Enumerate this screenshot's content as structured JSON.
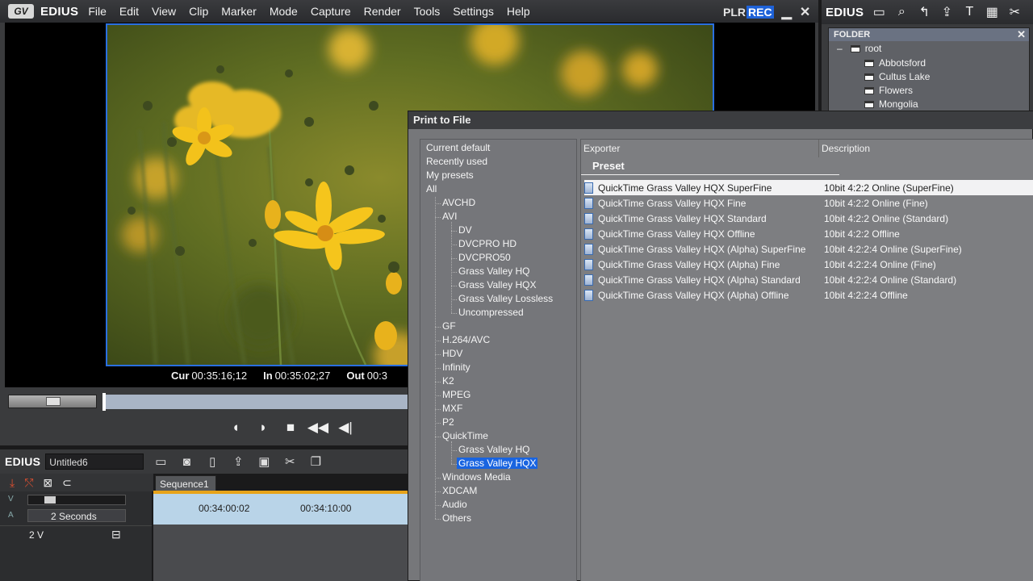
{
  "app": {
    "badge": "GV",
    "name": "EDIUS",
    "menu": [
      "File",
      "Edit",
      "View",
      "Clip",
      "Marker",
      "Mode",
      "Capture",
      "Render",
      "Tools",
      "Settings",
      "Help"
    ],
    "plr": "PLR",
    "rec": "REC"
  },
  "player": {
    "timecodes": [
      {
        "label": "Cur",
        "value": "00:35:16;12"
      },
      {
        "label": "In",
        "value": "00:35:02;27"
      },
      {
        "label": "Out",
        "value": "00:3"
      }
    ]
  },
  "timeline": {
    "brand": "EDIUS",
    "project": "Untitled6",
    "sequence_tab": "Sequence1",
    "zoom": "2 Seconds",
    "ruler_marks": [
      "00:34:00:02",
      "00:34:10:00"
    ],
    "track_name": "2 V"
  },
  "bin": {
    "brand": "EDIUS",
    "folder_header": "FOLDER",
    "root": "root",
    "folders": [
      "Abbotsford",
      "Cultus Lake",
      "Flowers",
      "Mongolia"
    ]
  },
  "dialog": {
    "title": "Print to File",
    "tree_top": [
      "Current default",
      "Recently used",
      "My presets",
      "All"
    ],
    "tree": [
      {
        "label": "AVCHD",
        "level": 1
      },
      {
        "label": "AVI",
        "level": 1
      },
      {
        "label": "DV",
        "level": 2
      },
      {
        "label": "DVCPRO HD",
        "level": 2
      },
      {
        "label": "DVCPRO50",
        "level": 2
      },
      {
        "label": "Grass Valley HQ",
        "level": 2
      },
      {
        "label": "Grass Valley HQX",
        "level": 2
      },
      {
        "label": "Grass Valley Lossless",
        "level": 2
      },
      {
        "label": "Uncompressed",
        "level": 2
      },
      {
        "label": "GF",
        "level": 1
      },
      {
        "label": "H.264/AVC",
        "level": 1
      },
      {
        "label": "HDV",
        "level": 1
      },
      {
        "label": "Infinity",
        "level": 1
      },
      {
        "label": "K2",
        "level": 1
      },
      {
        "label": "MPEG",
        "level": 1
      },
      {
        "label": "MXF",
        "level": 1
      },
      {
        "label": "P2",
        "level": 1
      },
      {
        "label": "QuickTime",
        "level": 1
      },
      {
        "label": "Grass Valley HQ",
        "level": 2
      },
      {
        "label": "Grass Valley HQX",
        "level": 2,
        "selected": true
      },
      {
        "label": "Windows Media",
        "level": 1
      },
      {
        "label": "XDCAM",
        "level": 1
      },
      {
        "label": "Audio",
        "level": 1
      },
      {
        "label": "Others",
        "level": 1
      }
    ],
    "columns": {
      "exporter": "Exporter",
      "description": "Description"
    },
    "preset_label": "Preset",
    "presets": [
      {
        "name": "QuickTime Grass Valley HQX SuperFine",
        "desc": "10bit 4:2:2 Online (SuperFine)",
        "selected": true
      },
      {
        "name": "QuickTime Grass Valley HQX Fine",
        "desc": "10bit 4:2:2 Online (Fine)"
      },
      {
        "name": "QuickTime Grass Valley HQX Standard",
        "desc": "10bit 4:2:2 Online (Standard)"
      },
      {
        "name": "QuickTime Grass Valley HQX Offline",
        "desc": "10bit 4:2:2 Offline"
      },
      {
        "name": "QuickTime Grass Valley HQX (Alpha) SuperFine",
        "desc": "10bit 4:2:2:4 Online (SuperFine)"
      },
      {
        "name": "QuickTime Grass Valley HQX (Alpha) Fine",
        "desc": "10bit 4:2:2:4 Online (Fine)"
      },
      {
        "name": "QuickTime Grass Valley HQX (Alpha) Standard",
        "desc": "10bit 4:2:2:4 Online (Standard)"
      },
      {
        "name": "QuickTime Grass Valley HQX (Alpha) Offline",
        "desc": "10bit 4:2:2:4 Offline"
      }
    ]
  },
  "colors": {
    "accent": "#1964e0",
    "frame_border": "#2a6fe0",
    "timeline_marker": "#e7a319"
  }
}
